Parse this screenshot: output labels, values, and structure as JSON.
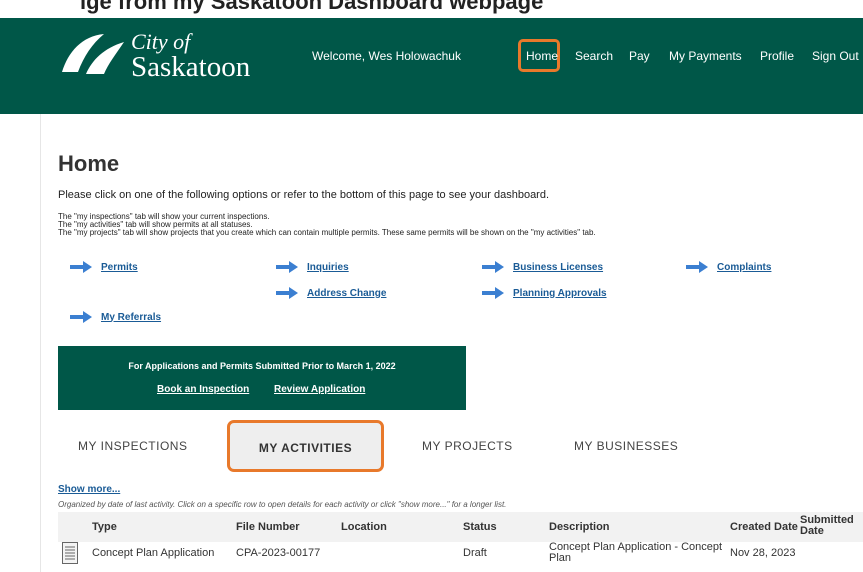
{
  "top_caption": "ige from my Saskatoon Dashboard webpage",
  "header": {
    "brand_city": "City of",
    "brand_name": "Saskatoon",
    "welcome": "Welcome, Wes Holowachuk",
    "nav": [
      "Home",
      "Search",
      "Pay",
      "My Payments",
      "Profile",
      "Sign Out"
    ],
    "bg_color": "#005748",
    "highlight_color": "#e8792b"
  },
  "page": {
    "title": "Home",
    "intro": "Please click on one of the following options or refer to the bottom of this page to see your dashboard.",
    "notes": [
      "The \"my inspections\" tab will show your current inspections.",
      "The \"my activities\" tab will show permits at all statuses.",
      "The \"my projects\" tab will show projects that you create which can contain multiple permits. These same permits will be shown on the \"my activities\" tab."
    ]
  },
  "quick_links": {
    "permits": "Permits",
    "inquiries": "Inquiries",
    "business_licenses": "Business Licenses",
    "complaints": "Complaints",
    "address_change": "Address Change",
    "planning_approvals": "Planning Approvals",
    "my_referrals": "My Referrals"
  },
  "banner": {
    "title": "For Applications and Permits Submitted Prior to March 1, 2022",
    "book_inspection": "Book an Inspection",
    "review_application": "Review Application"
  },
  "tabs": {
    "inspections": "MY INSPECTIONS",
    "activities": "MY ACTIVITIES",
    "projects": "MY PROJECTS",
    "businesses": "MY BUSINESSES",
    "active": "MY ACTIVITIES"
  },
  "table": {
    "show_more": "Show more...",
    "note": "Organized by date of last activity. Click on a specific row to open details for each activity or click \"show more...\" for a longer list.",
    "headers": {
      "type": "Type",
      "file_number": "File Number",
      "location": "Location",
      "status": "Status",
      "description": "Description",
      "created_date": "Created Date",
      "submitted_date": "Submitted Date"
    },
    "rows": [
      {
        "type": "Concept Plan Application",
        "file_number": "CPA-2023-00177",
        "location": "",
        "status": "Draft",
        "description": "Concept Plan Application - Concept Plan",
        "created_date": "Nov 28, 2023",
        "submitted_date": ""
      }
    ]
  }
}
